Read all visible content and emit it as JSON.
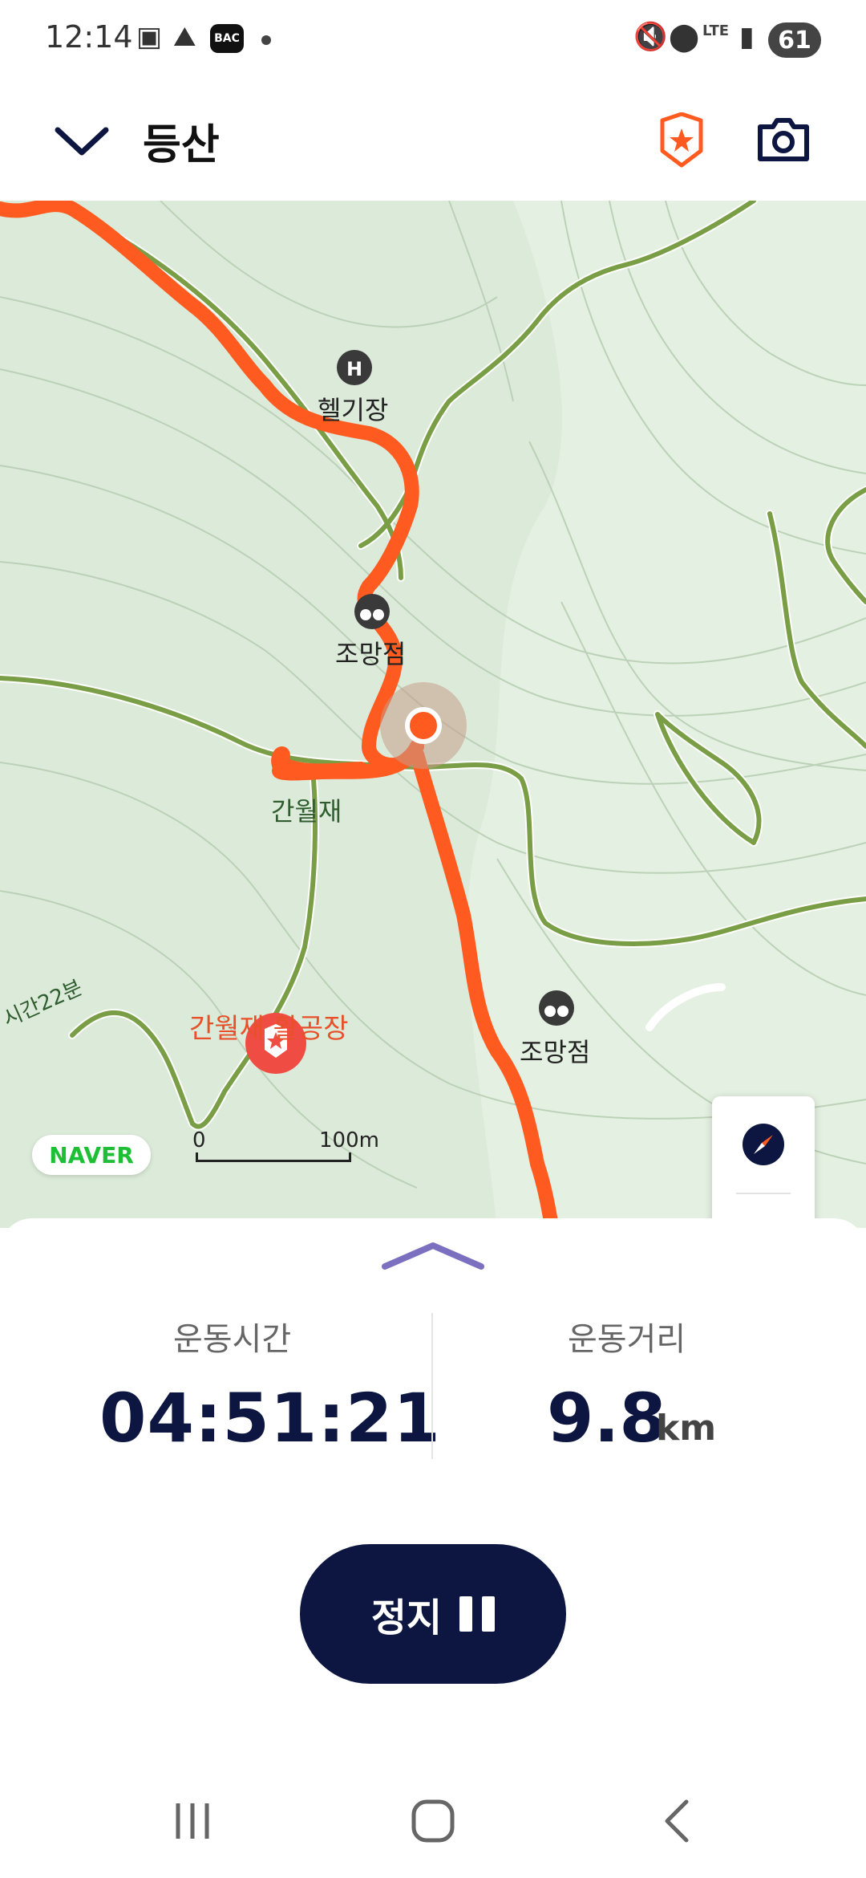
{
  "status": {
    "time": "12:14",
    "bac": "BAC",
    "lte": "LTE",
    "battery": "61"
  },
  "header": {
    "title": "등산"
  },
  "map": {
    "pois": {
      "helipad": "헬기장",
      "viewpoint1": "조망점",
      "viewpoint2": "조망점",
      "pass": "간월재",
      "hanggliding": "간월재 활공장",
      "trail_text": "시간22분"
    },
    "naver": "NAVER",
    "scale_start": "0",
    "scale_end": "100m",
    "route_color": "#ff5a1f",
    "trail_color": "#7a9e45"
  },
  "stats": {
    "time_label": "운동시간",
    "time_value": "04:51:21",
    "distance_label": "운동거리",
    "distance_value": "9.8",
    "distance_unit": "km"
  },
  "controls": {
    "stop_label": "정지"
  }
}
